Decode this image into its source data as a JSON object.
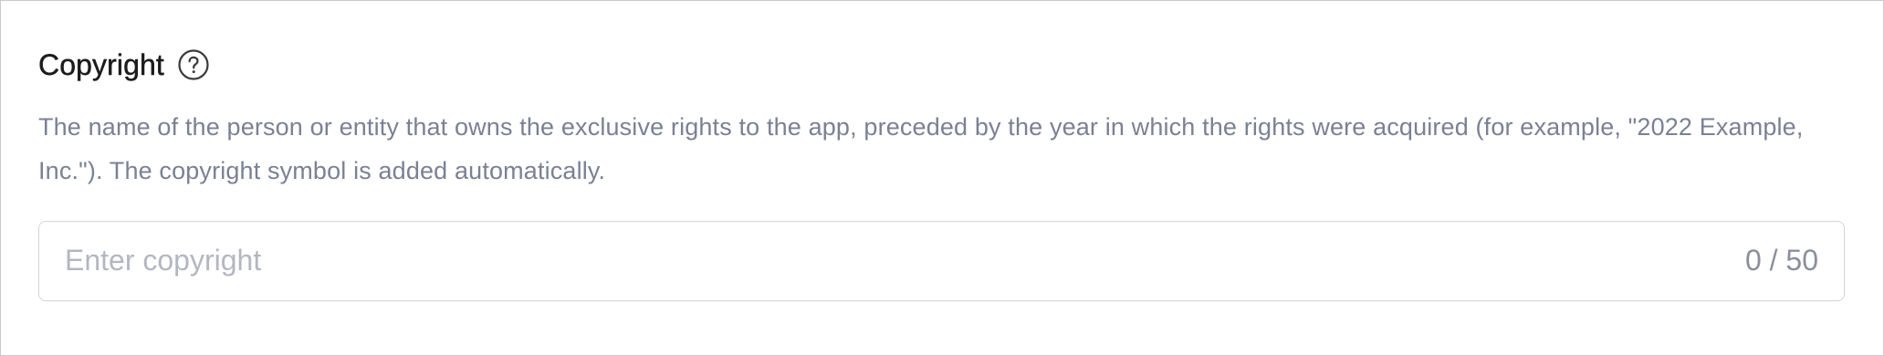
{
  "section": {
    "title": "Copyright",
    "help_icon": "question-circle-icon",
    "description": "The name of the person or entity that owns the exclusive rights to the app, preceded by the year in which the rights were acquired (for example, \"2022 Example, Inc.\"). The copyright symbol is added automatically."
  },
  "input": {
    "value": "",
    "placeholder": "Enter copyright",
    "counter": "0 / 50"
  },
  "colors": {
    "title": "#1c1c1e",
    "description": "#7a8194",
    "placeholder": "#b3b7c2",
    "border": "#d3d5da"
  }
}
